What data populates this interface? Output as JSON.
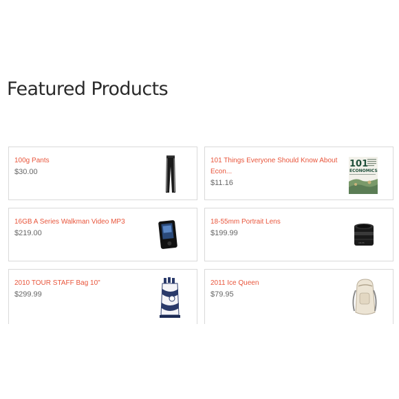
{
  "page": {
    "title": "Featured Products"
  },
  "products": [
    {
      "name": "100g Pants",
      "price": "$30.00",
      "thumb": "pants-icon"
    },
    {
      "name": "101 Things Everyone Should Know About Econ...",
      "price": "$11.16",
      "thumb": "book-icon",
      "thumb_text": "101 ECONOMICS"
    },
    {
      "name": "16GB A Series Walkman Video MP3",
      "price": "$219.00",
      "thumb": "mp3-player-icon"
    },
    {
      "name": "18-55mm Portrait Lens",
      "price": "$199.99",
      "thumb": "camera-lens-icon"
    },
    {
      "name": "2010 TOUR STAFF Bag 10\"",
      "price": "$299.99",
      "thumb": "golf-bag-icon"
    },
    {
      "name": "2011 Ice Queen",
      "price": "$79.95",
      "thumb": "backpack-icon"
    }
  ],
  "colors": {
    "link": "#e8543a",
    "price": "#666666",
    "border": "#d9d9d9",
    "title": "#2b2b2b"
  }
}
